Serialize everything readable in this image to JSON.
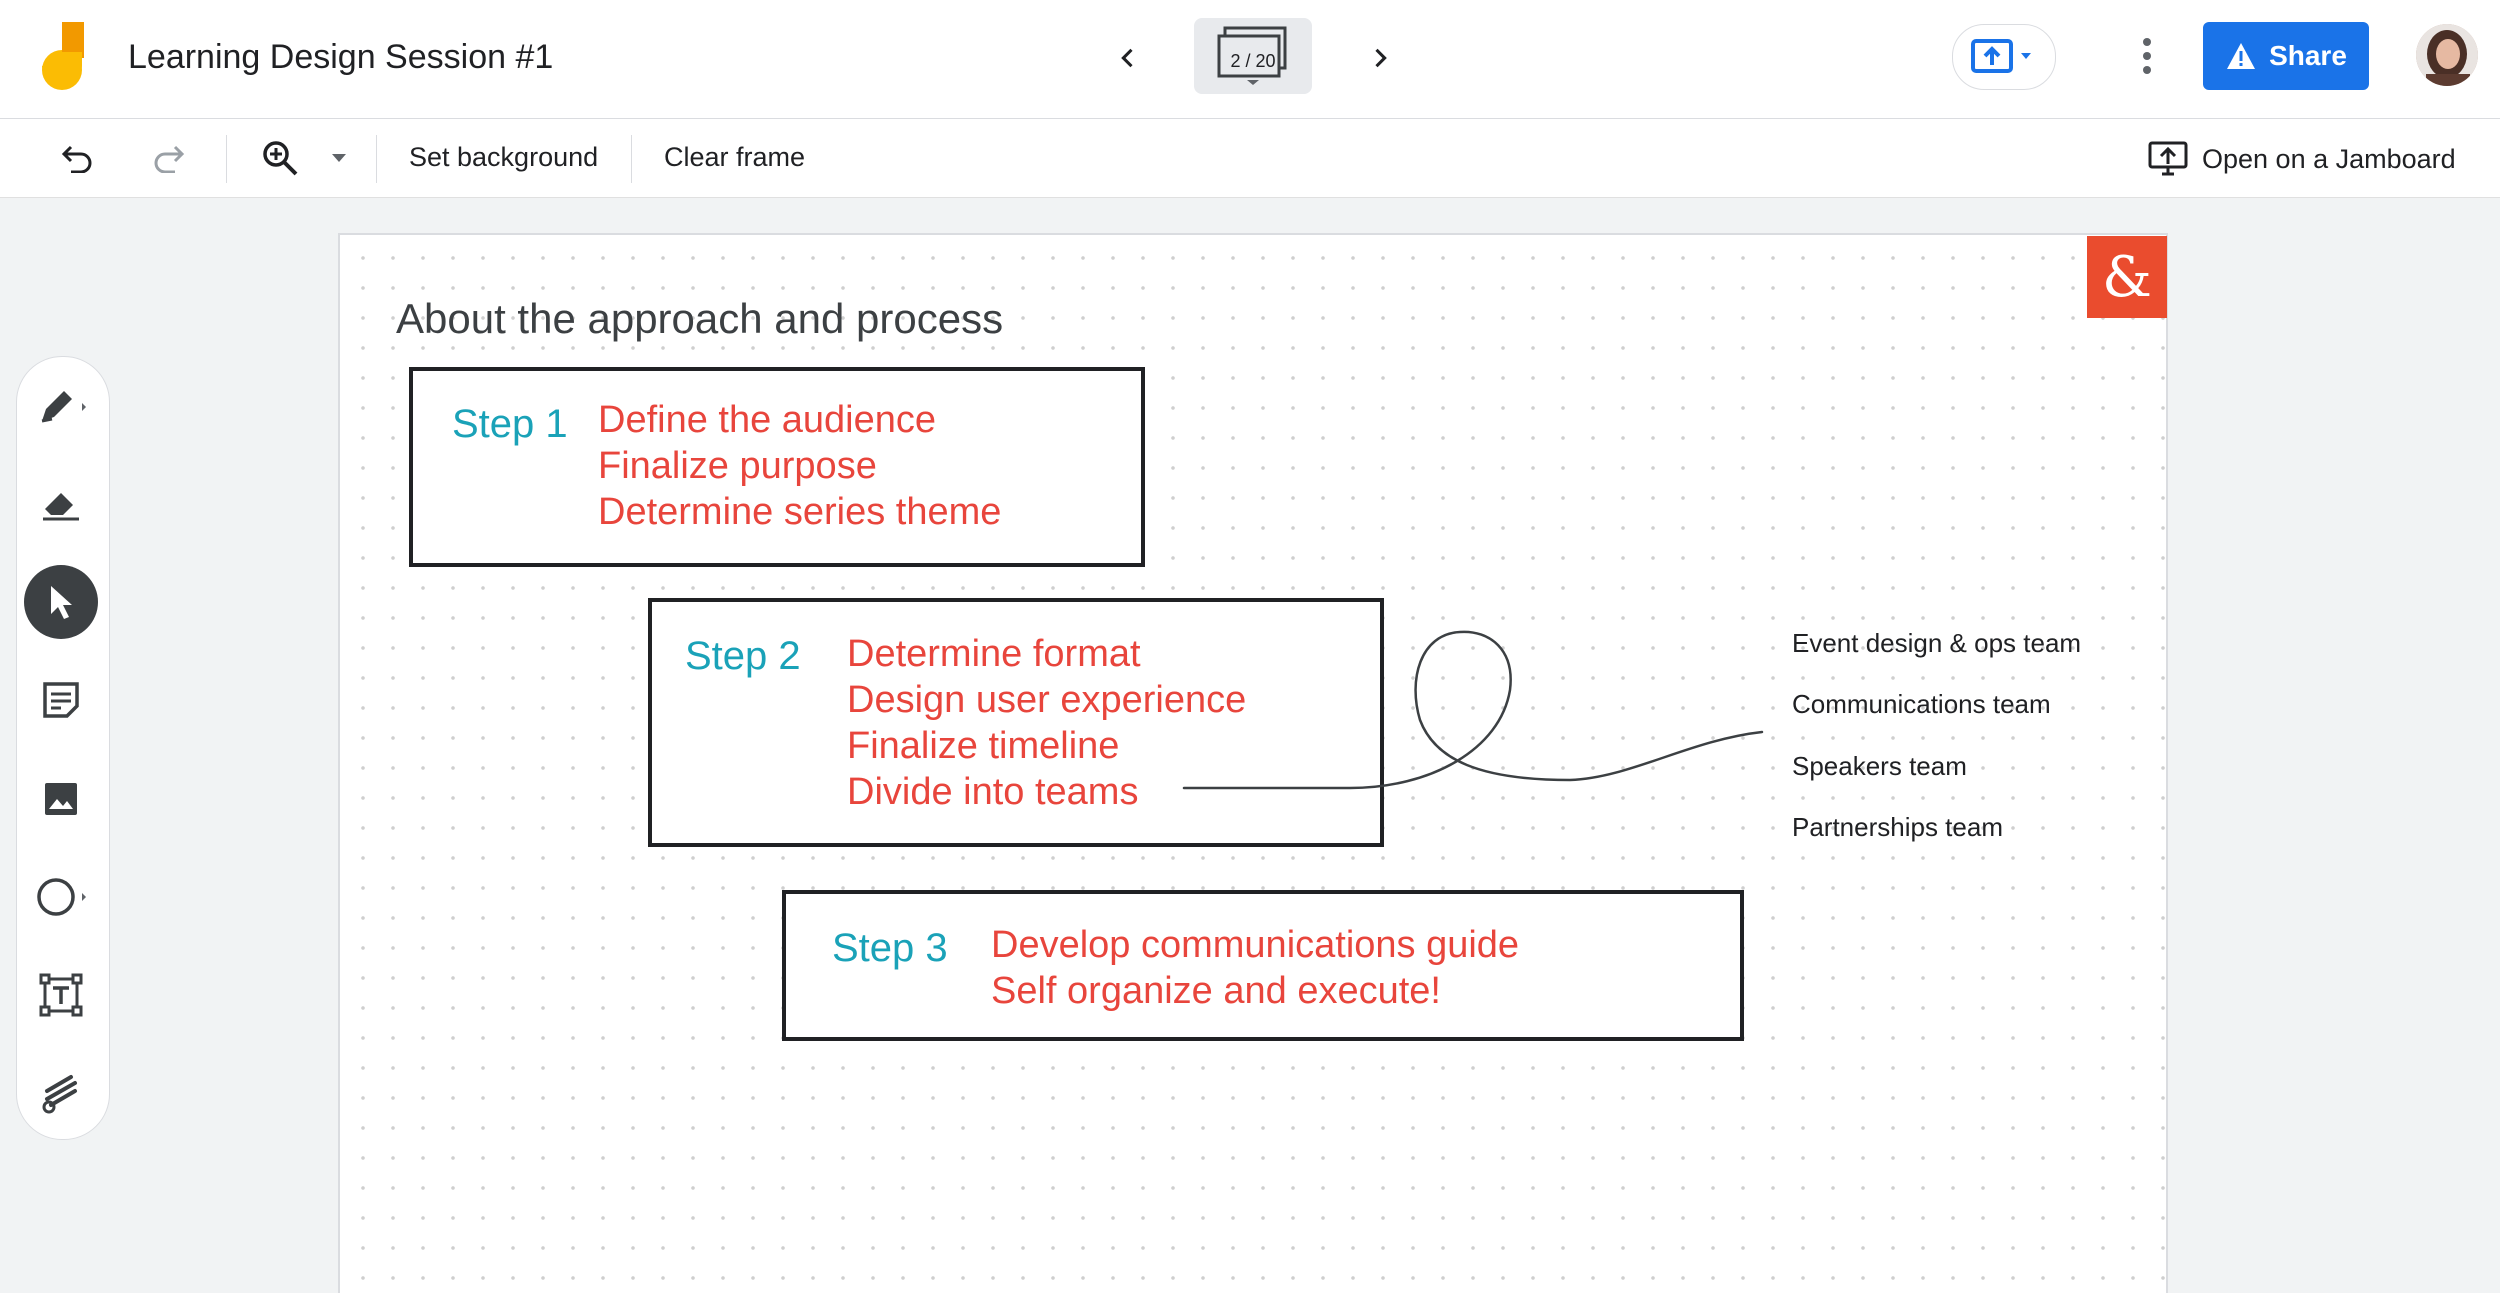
{
  "app": {
    "doc_title": "Learning Design Session #1",
    "frame_indicator": "2 / 20",
    "share_label": "Share",
    "colors": {
      "accent": "#1a73e8",
      "logo_yellow": "#fbbc04",
      "logo_orange": "#f29900"
    }
  },
  "toolbar": {
    "set_background": "Set background",
    "clear_frame": "Clear frame",
    "open_on_jamboard": "Open on a Jamboard"
  },
  "side_tools": [
    "pen-icon",
    "eraser-icon",
    "select-icon",
    "sticky-note-icon",
    "image-icon",
    "circle-icon",
    "text-box-icon",
    "laser-icon"
  ],
  "canvas": {
    "heading": "About the approach and process",
    "logo_text": "&",
    "steps": [
      {
        "label": "Step 1",
        "lines": [
          "Define the audience",
          "Finalize purpose",
          "Determine series theme"
        ]
      },
      {
        "label": "Step 2",
        "lines": [
          "Determine format",
          "Design user experience",
          "Finalize timeline",
          "Divide into teams"
        ]
      },
      {
        "label": "Step 3",
        "lines": [
          "Develop communications guide",
          "Self organize and execute!"
        ]
      }
    ],
    "teams": [
      "Event design & ops team",
      "Communications team",
      "Speakers team",
      "Partnerships team"
    ],
    "colors": {
      "step_label": "#1aa2b8",
      "step_text": "#e8453c",
      "logo_bg": "#ea4c2e"
    }
  }
}
